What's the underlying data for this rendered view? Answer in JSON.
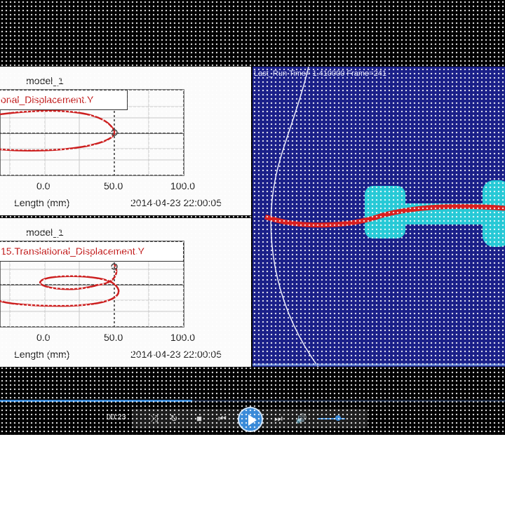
{
  "plots": [
    {
      "title": "model_1",
      "legend": "onal_Displacement.Y",
      "x_ticks": [
        "0.0",
        "50.0",
        "100.0"
      ],
      "xlabel": "Length (mm)",
      "timestamp": "2014-04-23 22:00:05"
    },
    {
      "title": "model_1",
      "legend": "15.Translational_Displacement.Y",
      "x_ticks": [
        "0.0",
        "50.0",
        "100.0"
      ],
      "xlabel": "Length (mm)",
      "timestamp": "2014-04-23 22:00:05"
    }
  ],
  "animation": {
    "info": "Last_Run   Time= 1.410000  Frame=241"
  },
  "player": {
    "current_time": "00:23",
    "progress": 0.38,
    "volume": 0.7
  },
  "colors": {
    "curve": "#cc1f1f",
    "animation_bg": "#1a1f88",
    "accent": "#3a8ad8",
    "part": "#27c9d6"
  },
  "icons": [
    "shuffle-icon",
    "repeat-icon",
    "stop-icon",
    "previous-icon",
    "play-icon",
    "next-icon",
    "volume-icon"
  ]
}
